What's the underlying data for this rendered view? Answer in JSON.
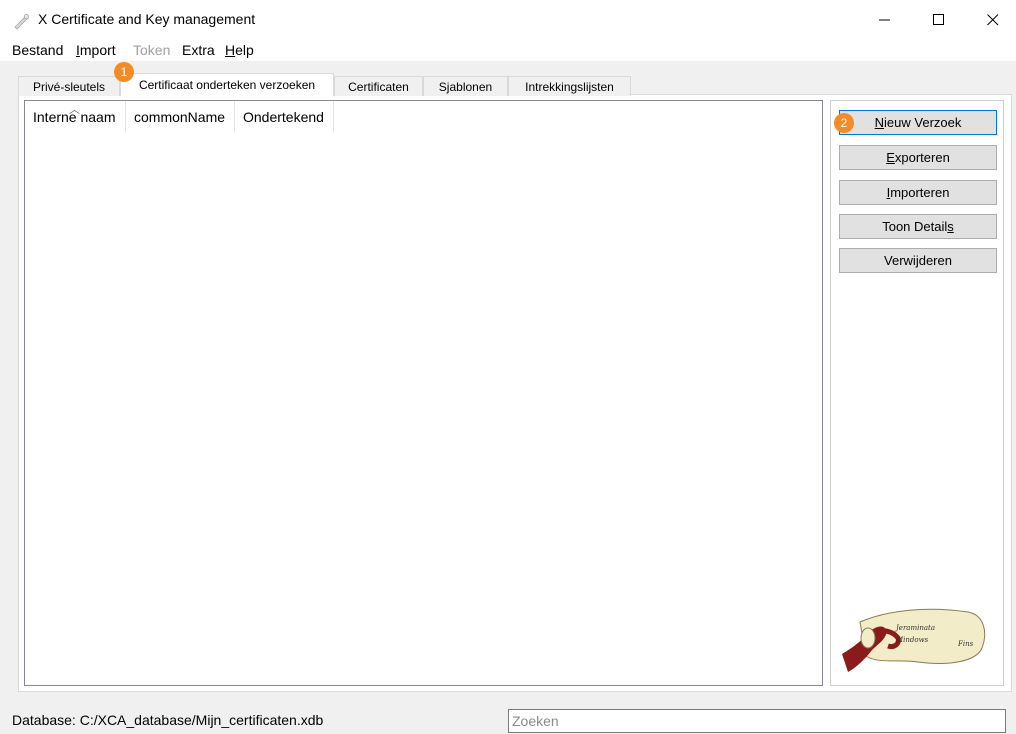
{
  "window": {
    "title": "X Certificate and Key management"
  },
  "menu": {
    "bestand": "Bestand",
    "import_u": "I",
    "import_rest": "mport",
    "token": "Token",
    "extra": "Extra",
    "help_u": "H",
    "help_rest": "elp"
  },
  "tabs": [
    {
      "label": "Privé-sleutels"
    },
    {
      "label": "Certificaat onderteken verzoeken"
    },
    {
      "label": "Certificaten"
    },
    {
      "label": "Sjablonen"
    },
    {
      "label": "Intrekkingslijsten"
    }
  ],
  "table": {
    "columns": [
      "Interne naam",
      "commonName",
      "Ondertekend"
    ],
    "rows": []
  },
  "buttons": {
    "nieuw_u": "N",
    "nieuw_rest": "ieuw Verzoek",
    "export_u": "E",
    "export_rest": "xporteren",
    "import_u": "I",
    "import_rest": "mporteren",
    "details_pre": "Toon Detail",
    "details_u": "s",
    "delete_pre": "Verwi",
    "delete_u": "j",
    "delete_post": "deren"
  },
  "badges": {
    "one": "1",
    "two": "2"
  },
  "logo": {
    "line1": "Jeraminata",
    "line2": "Mindows",
    "line3": "Fins"
  },
  "status": {
    "database": "Database: C:/XCA_database/Mijn_certificaten.xdb"
  },
  "search": {
    "placeholder": "Zoeken",
    "value": ""
  },
  "colors": {
    "badge": "#f28c28",
    "focus": "#0078d7",
    "logo_ribbon": "#8b1a1a",
    "logo_paper": "#f3ecc8"
  }
}
